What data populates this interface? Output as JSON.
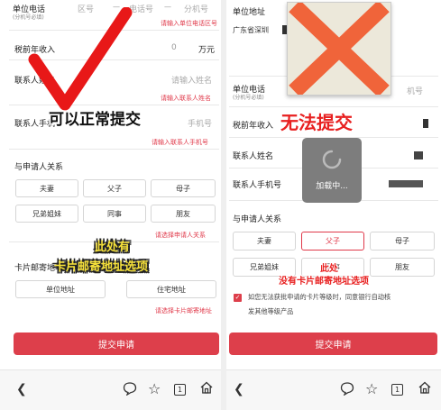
{
  "left": {
    "work_phone_label": "单位电话",
    "work_phone_sub": "(分机号必填)",
    "area_code_ph": "区号",
    "phone_ph": "电话号",
    "ext_ph": "分机号",
    "work_phone_err": "请输入单位电话区号",
    "income_label": "税前年收入",
    "income_value": "0",
    "income_unit": "万元",
    "contact_name_label": "联系人姓名",
    "contact_name_ph": "请输入姓名",
    "contact_name_err": "请输入联系人姓名",
    "contact_phone_label": "联系人手机",
    "contact_phone_ph": "手机号",
    "contact_phone_err": "请输入联系人手机号",
    "relation_label": "与申请人关系",
    "relations": [
      "夫妻",
      "父子",
      "母子",
      "兄弟姐妹",
      "同事",
      "朋友"
    ],
    "relation_err": "请选择申请人关系",
    "mail_label": "卡片邮寄地址",
    "mail_options": [
      "单位地址",
      "住宅地址"
    ],
    "mail_err": "请选择卡片邮寄地址",
    "submit": "提交申请",
    "overlay_ok": "可以正常提交",
    "overlay_here_1": "此处有",
    "overlay_here_2": "卡片邮寄地址选项"
  },
  "right": {
    "work_addr_label": "单位地址",
    "work_addr_value": "广东省深圳",
    "work_phone_label": "单位电话",
    "work_phone_sub": "(分机号必填)",
    "ext_ph": "机号",
    "income_label": "税前年收入",
    "contact_name_label": "联系人姓名",
    "contact_phone_label": "联系人手机号",
    "loading": "加载中...",
    "relation_label": "与申请人关系",
    "relations": [
      "夫妻",
      "父子",
      "母子",
      "兄弟姐妹",
      "同事",
      "朋友"
    ],
    "selected_relation": "父子",
    "agree_text_1": "如您无法获批申请的卡片等级时，同意银行自动核",
    "agree_text_2": "发其他等级产品",
    "submit": "提交申请",
    "overlay_fail": "无法提交",
    "overlay_none_1": "此处",
    "overlay_none_2": "没有卡片邮寄地址选项"
  },
  "colors": {
    "accent_red": "#dd3f4b",
    "overlay_red": "#e82020",
    "overlay_yellow": "#f7e23a"
  }
}
